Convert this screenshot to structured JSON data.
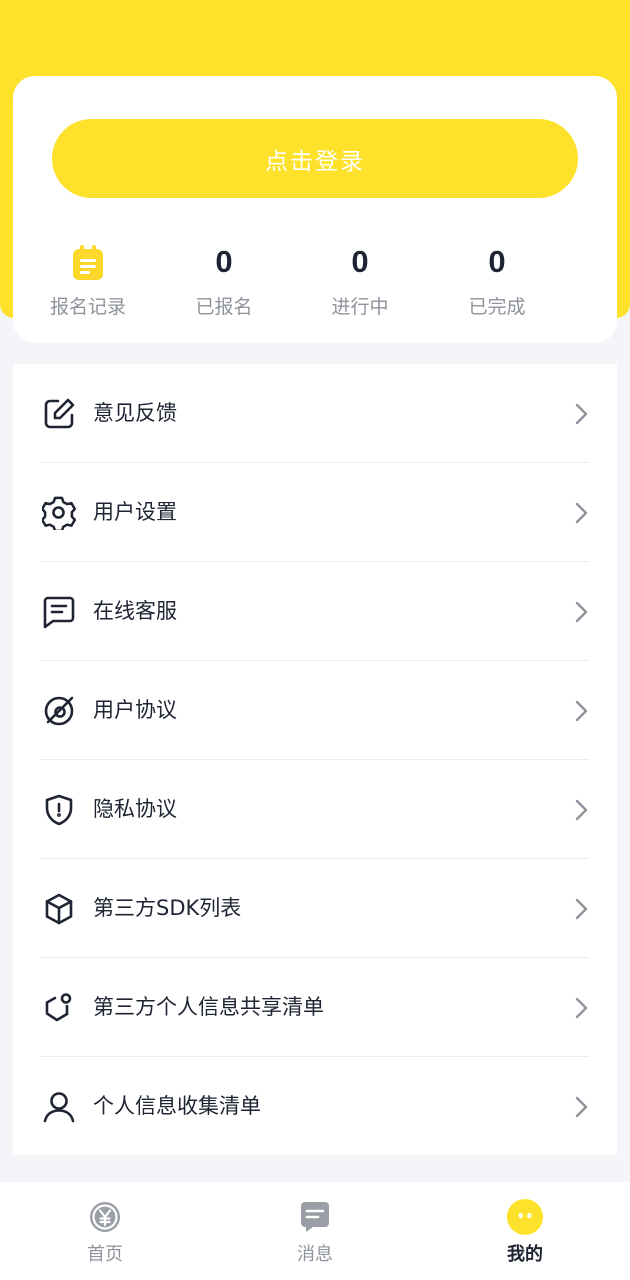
{
  "colors": {
    "brand_yellow": "#fde12b",
    "text_dark": "#1f2433",
    "text_muted": "#8e939c",
    "background": "#f4f5f8"
  },
  "profile": {
    "login_label": "点击登录",
    "stats": [
      {
        "icon": "signup-record-icon",
        "label": "报名记录"
      },
      {
        "value": "0",
        "label": "已报名"
      },
      {
        "value": "0",
        "label": "进行中"
      },
      {
        "value": "0",
        "label": "已完成"
      }
    ]
  },
  "menu": {
    "items": [
      {
        "icon": "edit-icon",
        "label": "意见反馈"
      },
      {
        "icon": "gear-icon",
        "label": "用户设置"
      },
      {
        "icon": "chat-icon",
        "label": "在线客服"
      },
      {
        "icon": "agreement-icon",
        "label": "用户协议"
      },
      {
        "icon": "shield-icon",
        "label": "隐私协议"
      },
      {
        "icon": "cube-icon",
        "label": "第三方SDK列表"
      },
      {
        "icon": "share-icon",
        "label": "第三方个人信息共享清单"
      },
      {
        "icon": "user-icon",
        "label": "个人信息收集清单"
      }
    ]
  },
  "tabbar": {
    "items": [
      {
        "icon": "yen-icon",
        "label": "首页",
        "active": false
      },
      {
        "icon": "message-icon",
        "label": "消息",
        "active": false
      },
      {
        "icon": "mine-icon",
        "label": "我的",
        "active": true
      }
    ]
  }
}
